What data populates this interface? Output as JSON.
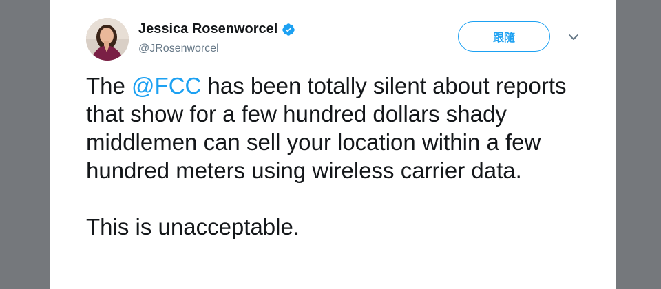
{
  "author": {
    "name": "Jessica Rosenworcel",
    "handle": "@JRosenworcel",
    "verified_icon": "verified-badge-icon"
  },
  "actions": {
    "follow_label": "跟隨",
    "menu_icon": "chevron-down-icon"
  },
  "tweet": {
    "pre_mention": "The ",
    "mention": "@FCC",
    "post_mention": " has been totally silent about reports that show for a few hundred dollars shady middlemen can sell your location within a few hundred meters using wireless carrier data.",
    "second_paragraph": "This is unacceptable."
  },
  "colors": {
    "accent": "#1da1f2",
    "text": "#14171a",
    "secondary": "#657786",
    "background": "#75787c"
  }
}
